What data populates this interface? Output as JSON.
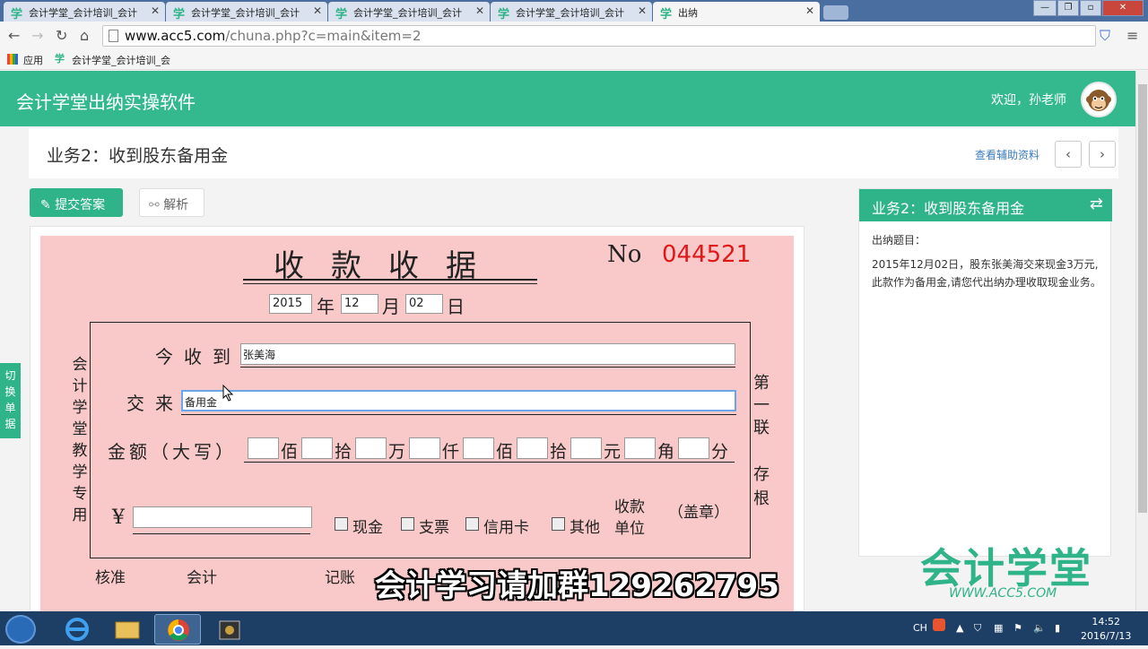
{
  "browser": {
    "tabs": [
      {
        "label": "会计学堂_会计培训_会计"
      },
      {
        "label": "会计学堂_会计培训_会计"
      },
      {
        "label": "会计学堂_会计培训_会计"
      },
      {
        "label": "会计学堂_会计培训_会计"
      },
      {
        "label": "出纳"
      }
    ],
    "tab_icon": "学",
    "close_glyph": "✕",
    "url_host": "www.acc5.com",
    "url_path": "/chuna.php?c=main&item=2",
    "bookmarks": {
      "apps_label": "应用",
      "item": "会计学堂_会计培训_会"
    }
  },
  "app": {
    "title": "会计学堂出纳实操软件",
    "welcome": "欢迎，孙老师",
    "accent_color": "#34b98e"
  },
  "task": {
    "title": "业务2：收到股东备用金",
    "ref_link": "查看辅助资料",
    "prev_icon": "‹",
    "next_icon": "›"
  },
  "actions": {
    "submit": "提交答案",
    "analyze": "解析",
    "switch_vertical": [
      "切",
      "换",
      "单",
      "据"
    ]
  },
  "receipt": {
    "title": "收款收据",
    "no_label": "No",
    "no_value": "044521",
    "date": {
      "year": "2015",
      "year_label": "年",
      "month": "12",
      "month_label": "月",
      "day": "02",
      "day_label": "日"
    },
    "left_side_text": [
      "会",
      "计",
      "学",
      "堂",
      "教",
      "学",
      "专",
      "用"
    ],
    "right_side_text_1": [
      "第",
      "一",
      "联"
    ],
    "right_side_text_2": [
      "存",
      "根"
    ],
    "received_from_label": "今收到",
    "received_from_value": "张美海",
    "purpose_label": "交来",
    "purpose_value": "备用金",
    "amount_words_label": "金额（大写）",
    "amount_units": [
      "佰",
      "拾",
      "万",
      "仟",
      "佰",
      "拾",
      "元",
      "角",
      "分"
    ],
    "yen_symbol": "¥",
    "yen_value": "",
    "payment_methods": [
      "现金",
      "支票",
      "信用卡",
      "其他"
    ],
    "payee_unit_label_1": "收款",
    "payee_unit_label_2": "单位",
    "seal_label": "（盖章）",
    "footer": {
      "approve": "核准",
      "accounting": "会计",
      "bookkeeping": "记账"
    }
  },
  "side_panel": {
    "title": "业务2：收到股东备用金",
    "switch_icon": "⇄",
    "label": "出纳题目：",
    "text": "2015年12月02日，股东张美海交来现金3万元,此款作为备用金,请您代出纳办理收取现金业务。"
  },
  "overlay_text": "会计学习请加群129262795",
  "watermark": {
    "main": "会计学堂",
    "sub": "WWW.ACC5.COM"
  },
  "taskbar": {
    "lang": "CH",
    "time": "14:52",
    "date": "2016/7/13"
  }
}
